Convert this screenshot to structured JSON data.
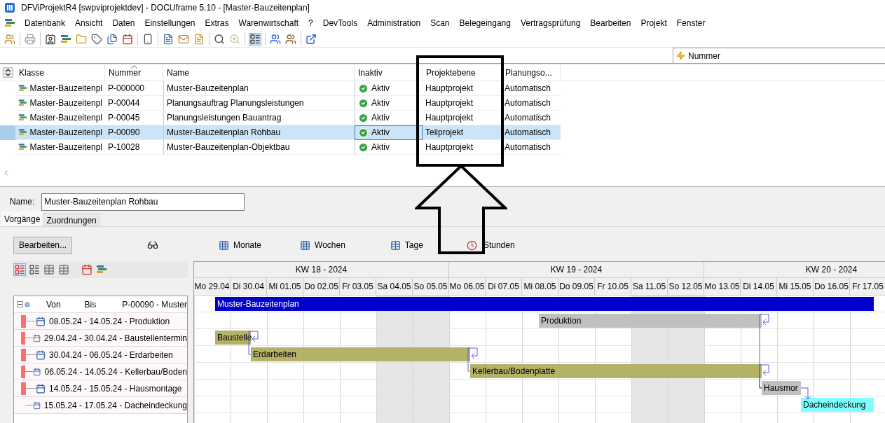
{
  "window": {
    "title": "DFViProjektR4 [swpviprojektdev] - DOCUframe 5.10 - [Master-Bauzeitenplan]"
  },
  "menu": [
    "Datenbank",
    "Ansicht",
    "Daten",
    "Einstellungen",
    "Extras",
    "Warenwirtschaft",
    "?",
    "DevTools",
    "Administration",
    "Scan",
    "Belegeingang",
    "Vertragsprüfung",
    "Bearbeiten",
    "Projekt",
    "Fenster"
  ],
  "filter": {
    "value": "Nummer"
  },
  "table": {
    "columns": [
      {
        "label": "Klasse",
        "sorted": false
      },
      {
        "label": "Nummer",
        "sorted": true
      },
      {
        "label": "Name",
        "sorted": false
      },
      {
        "label": "Inaktiv",
        "sorted": false
      },
      {
        "label": "Projektebene",
        "sorted": false
      },
      {
        "label": "Planungso...",
        "sorted": false
      }
    ],
    "rows": [
      {
        "klasse": "Master-Bauzeitenpl",
        "nummer": "P-000000",
        "name": "Muster-Bauzeitenplan",
        "inaktiv": "Aktiv",
        "ebene": "Hauptprojekt",
        "planung": "Automatisch",
        "selected": false
      },
      {
        "klasse": "Master-Bauzeitenpl",
        "nummer": "P-00044",
        "name": "Planungsauftrag Planungsleistungen",
        "inaktiv": "Aktiv",
        "ebene": "Hauptprojekt",
        "planung": "Automatisch",
        "selected": false
      },
      {
        "klasse": "Master-Bauzeitenpl",
        "nummer": "P-00045",
        "name": "Planungsleistungen Bauantrag",
        "inaktiv": "Aktiv",
        "ebene": "Hauptprojekt",
        "planung": "Automatisch",
        "selected": false
      },
      {
        "klasse": "Master-Bauzeitenpl",
        "nummer": "P-00090",
        "name": "Muster-Bauzeitenplan Rohbau",
        "inaktiv": "Aktiv",
        "ebene": "Teilprojekt",
        "planung": "Automatisch",
        "selected": true
      },
      {
        "klasse": "Master-Bauzeitenpl",
        "nummer": "P-10028",
        "name": "Muster-Bauzeitenplan-Objektbau",
        "inaktiv": "Aktiv",
        "ebene": "Hauptprojekt",
        "planung": "Automatisch",
        "selected": false
      }
    ]
  },
  "detail": {
    "name_label": "Name:",
    "name_value": "Muster-Bauzeitenplan Rohbau",
    "tabs": [
      {
        "label": "Vorgänge",
        "selected": true
      },
      {
        "label": "Zuordnungen",
        "selected": false
      }
    ],
    "edit_button": "Bearbeiten...",
    "views": [
      "Monate",
      "Wochen",
      "Tage",
      "Stunden"
    ]
  },
  "tree": {
    "expanded": true,
    "columns": [
      "Von",
      "Bis",
      "P-00090 - Muster"
    ],
    "items": [
      {
        "label": "08.05.24 - 14.05.24 - Produktion",
        "flagged": true
      },
      {
        "label": "29.04.24 - 30.04.24 - Baustellentermin",
        "flagged": true
      },
      {
        "label": "30.04.24 - 06.05.24 - Erdarbeiten",
        "flagged": true
      },
      {
        "label": "06.05.24 - 14.05.24 - Kellerbau/Boden",
        "flagged": true
      },
      {
        "label": "14.05.24 - 15.05.24 - Hausmontage",
        "flagged": true
      },
      {
        "label": "15.05.24 - 17.05.24 - Dacheindeckung",
        "flagged": false
      }
    ]
  },
  "gantt": {
    "weeks": [
      "KW 18 - 2024",
      "KW 19 - 2024",
      "KW 20 - 2024"
    ],
    "days": [
      {
        "label": "Mo 29.04",
        "weekend": false
      },
      {
        "label": "Di 30.04",
        "weekend": false
      },
      {
        "label": "Mi 01.05",
        "weekend": false
      },
      {
        "label": "Do 02.05",
        "weekend": false
      },
      {
        "label": "Fr 03.05",
        "weekend": false
      },
      {
        "label": "Sa 04.05",
        "weekend": true
      },
      {
        "label": "So 05.05",
        "weekend": true
      },
      {
        "label": "Mo 06.05",
        "weekend": false
      },
      {
        "label": "Di 07.05",
        "weekend": false
      },
      {
        "label": "Mi 08.05",
        "weekend": false
      },
      {
        "label": "Do 09.05",
        "weekend": false
      },
      {
        "label": "Fr 10.05",
        "weekend": false
      },
      {
        "label": "Sa 11.05",
        "weekend": true
      },
      {
        "label": "So 12.05",
        "weekend": true
      },
      {
        "label": "Mo 13.05",
        "weekend": false
      },
      {
        "label": "Di 14.05",
        "weekend": false
      },
      {
        "label": "Mi 15.05",
        "weekend": false
      },
      {
        "label": "Do 16.05",
        "weekend": false
      },
      {
        "label": "Fr 17.05",
        "weekend": false
      }
    ],
    "bars": [
      {
        "label": "Muster-Bauzeitenplan",
        "color": "#0000cc"
      },
      {
        "label": "Produktion",
        "color": "#c0c0c0"
      },
      {
        "label": "Baustelle",
        "color": "#b3b266"
      },
      {
        "label": "Erdarbeiten",
        "color": "#b3b266"
      },
      {
        "label": "Kellerbau/Bodenplatte",
        "color": "#b3b266"
      },
      {
        "label": "Hausmor",
        "color": "#c0c0c0"
      },
      {
        "label": "Dacheindeckung",
        "color": "#80ffff"
      }
    ]
  }
}
